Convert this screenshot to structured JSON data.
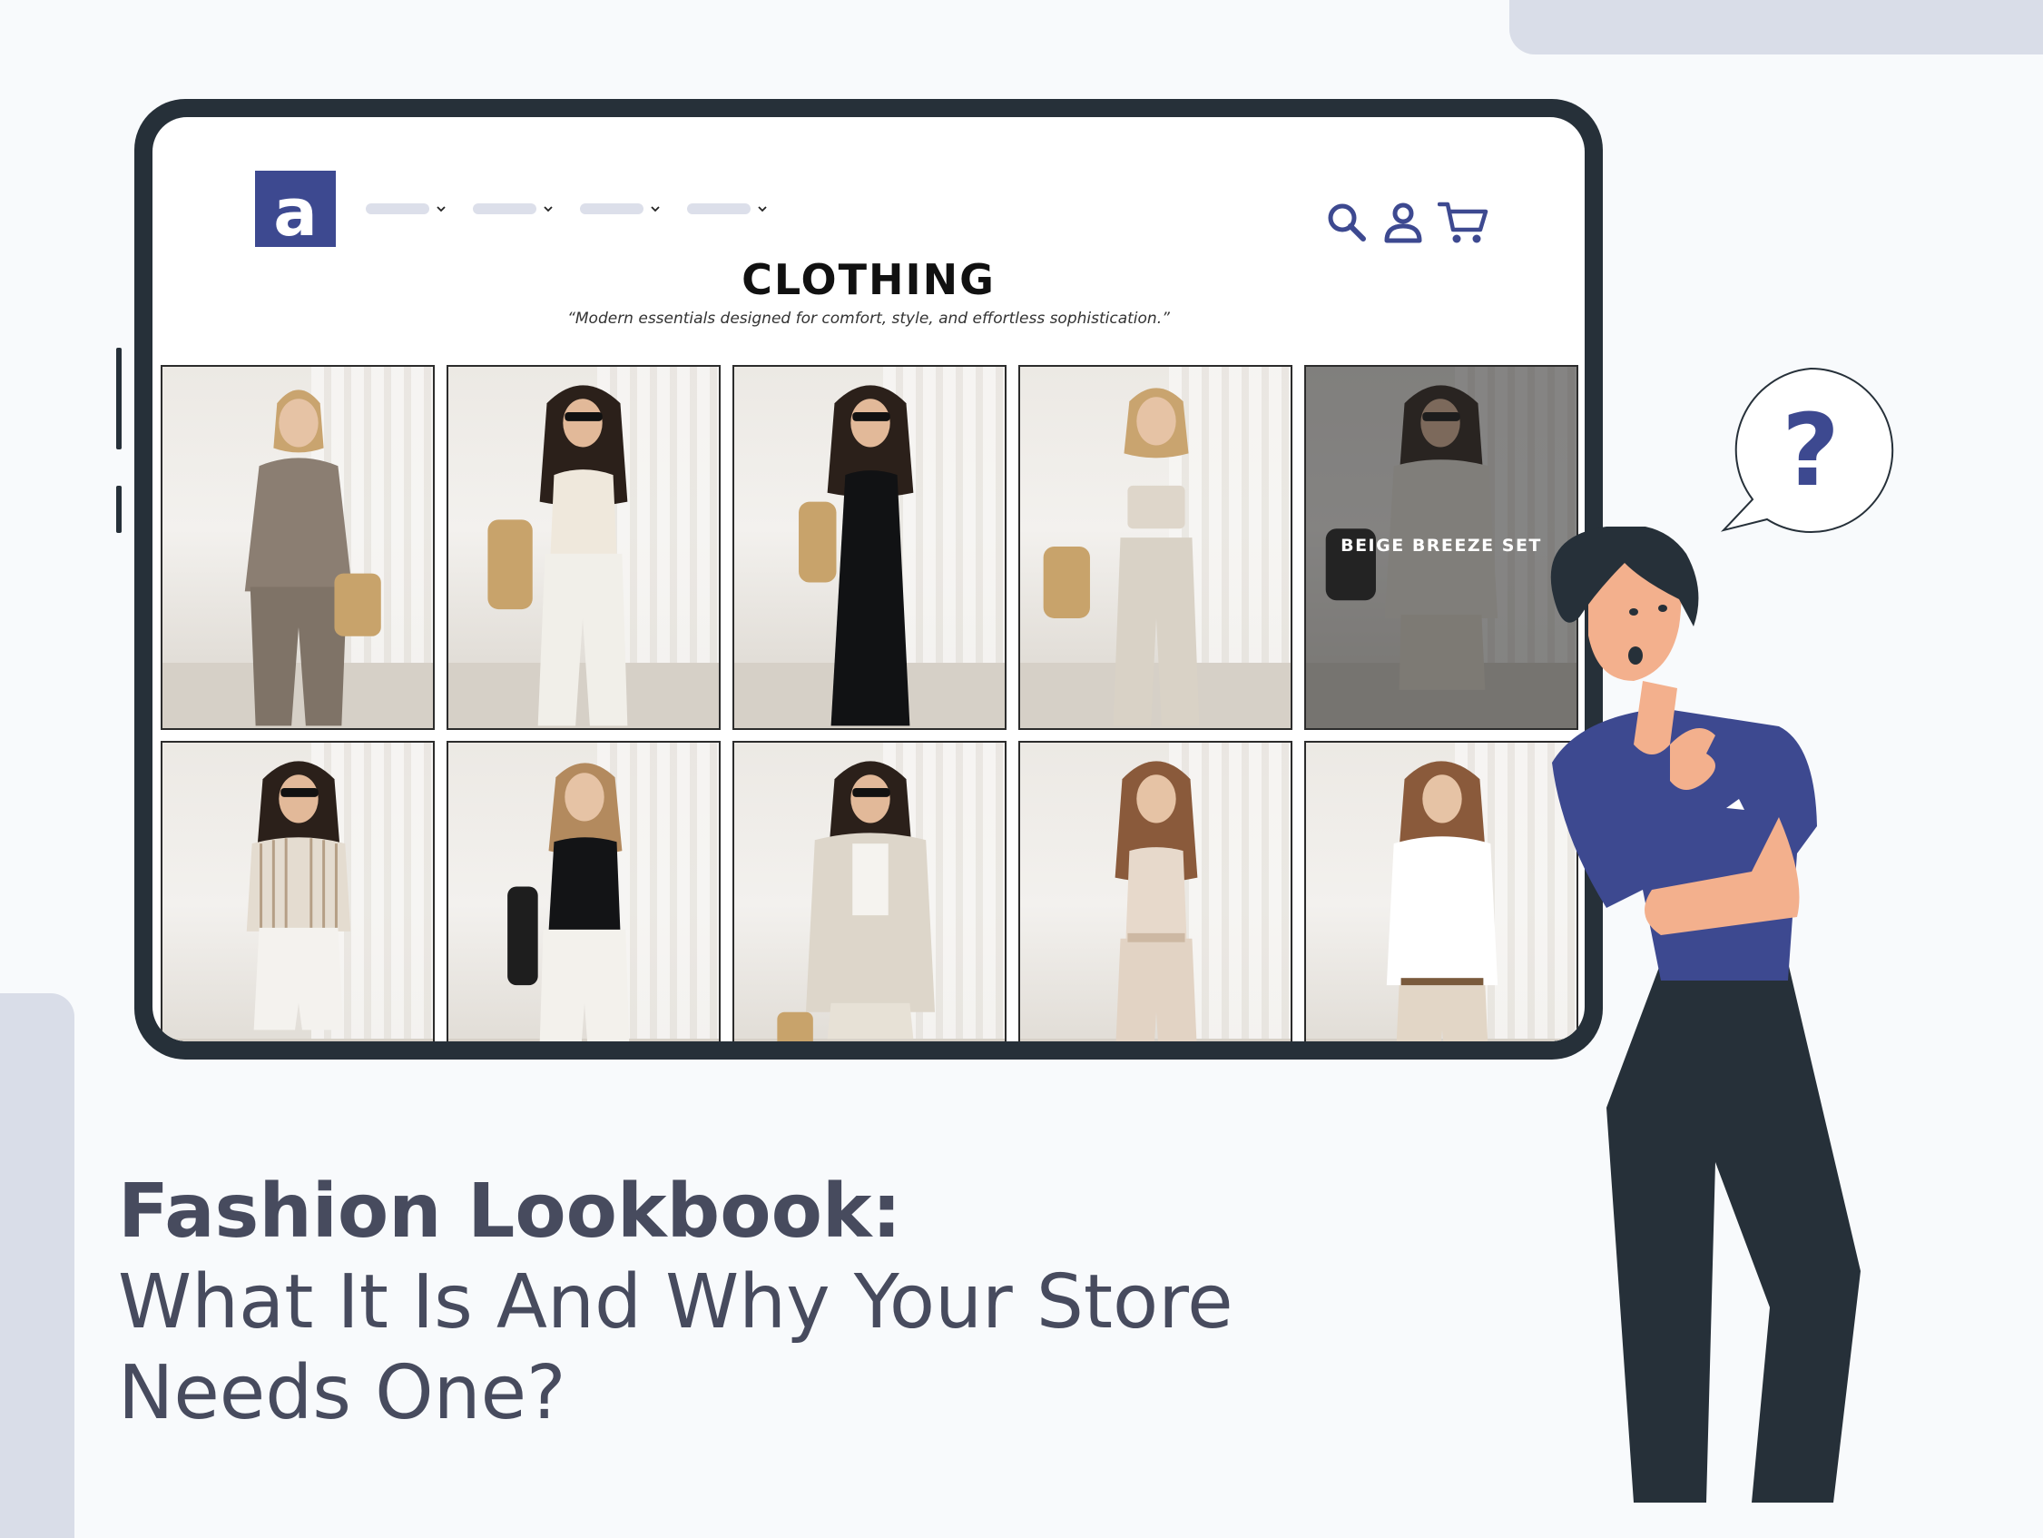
{
  "store": {
    "logo_letter": "a",
    "page_title": "CLOTHING",
    "page_subtitle": "“Modern essentials designed for comfort, style, and effortless sophistication.”"
  },
  "nav": {
    "items": [
      "",
      "",
      "",
      ""
    ]
  },
  "header_icons": [
    "search-icon",
    "user-icon",
    "cart-icon"
  ],
  "products": [
    {
      "label": "",
      "outfit": "taupe-shirt-trousers"
    },
    {
      "label": "",
      "outfit": "cream-tank-white-pants"
    },
    {
      "label": "",
      "outfit": "black-maxi-dress"
    },
    {
      "label": "",
      "outfit": "bandeau-beige-pants"
    },
    {
      "label": "BEIGE BREEZE SET",
      "outfit": "beige-shirt-shorts"
    },
    {
      "label": "",
      "outfit": "striped-shirt-white-shorts"
    },
    {
      "label": "",
      "outfit": "black-tank-white-pants"
    },
    {
      "label": "",
      "outfit": "linen-blazer-shorts"
    },
    {
      "label": "",
      "outfit": "beige-jumpsuit"
    },
    {
      "label": "",
      "outfit": "white-shirt-beige-pants"
    }
  ],
  "headline": {
    "bold": "Fashion Lookbook:",
    "line2": "What It Is And Why Your Store",
    "line3": "Needs One?"
  },
  "speech_bubble": {
    "text": "?"
  },
  "colors": {
    "brand": "#3d4990",
    "device_frame": "#263039",
    "headline_text": "#474b5e",
    "deco_shape": "#d9dde8"
  }
}
